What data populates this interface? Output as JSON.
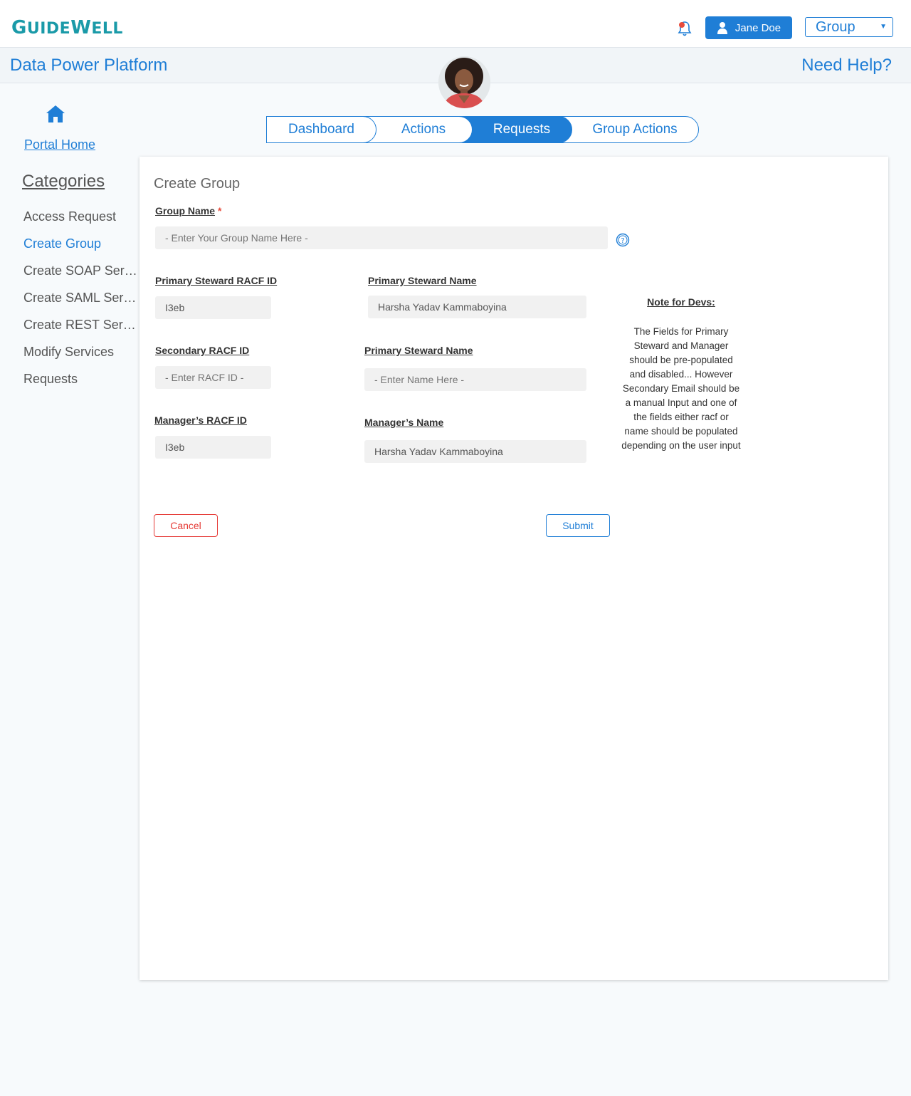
{
  "header": {
    "logo_first": "G",
    "logo_rest": "UIDE",
    "logo_second": "W",
    "logo_end": "ELL",
    "user_name": "Jane Doe",
    "group_select": "Group"
  },
  "subheader": {
    "title": "Data Power Platform",
    "help": "Need Help?"
  },
  "sidebar": {
    "portal_home": "Portal Home",
    "categories_title": "Categories",
    "items": [
      {
        "label": "Access Request"
      },
      {
        "label": "Create Group"
      },
      {
        "label": "Create SOAP Servi..."
      },
      {
        "label": "Create SAML Servi..."
      },
      {
        "label": "Create REST Servi..."
      },
      {
        "label": "Modify Services"
      },
      {
        "label": "Requests"
      }
    ]
  },
  "tabs": [
    {
      "label": "Dashboard"
    },
    {
      "label": "Actions"
    },
    {
      "label": "Requests"
    },
    {
      "label": "Group Actions"
    }
  ],
  "form": {
    "title": "Create Group",
    "group_name_label": "Group Name",
    "required_mark": "*",
    "group_name_placeholder": "- Enter Your Group Name Here -",
    "primary_racf_label": "Primary  Steward RACF ID",
    "primary_racf_value": "I3eb",
    "primary_name_label": "Primary Steward Name",
    "primary_name_value": "Harsha Yadav Kammaboyina",
    "secondary_racf_label": "Secondary RACF ID",
    "secondary_racf_placeholder": "- Enter RACF ID -",
    "secondary_name_label": "Primary Steward Name",
    "secondary_name_placeholder": "- Enter Name Here -",
    "manager_racf_label": "Manager’s RACF ID",
    "manager_racf_value": "I3eb",
    "manager_name_label": "Manager’s Name",
    "manager_name_value": "Harsha Yadav Kammaboyina",
    "cancel": "Cancel",
    "submit": "Submit"
  },
  "note": {
    "title": "Note for Devs:",
    "body": "The Fields for Primary Steward and Manager should be pre-populated and disabled... However Secondary Email should be a manual Input and one of the fields either racf or name should be populated depending on the user input"
  },
  "colors": {
    "accent": "#1f7ed6",
    "brand_teal": "#1a9aa8",
    "danger": "#e53935"
  }
}
